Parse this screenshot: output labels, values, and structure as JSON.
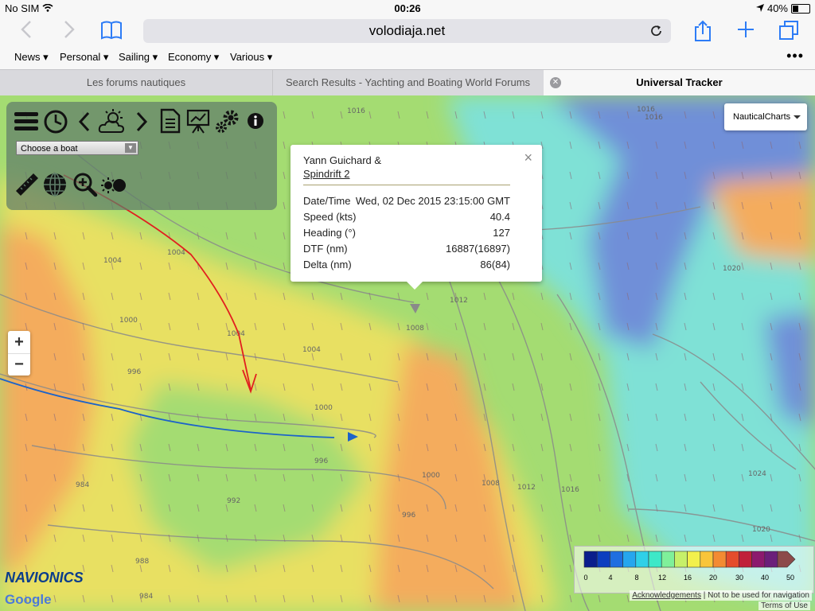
{
  "status": {
    "carrier": "No SIM",
    "wifi_icon": "wifi-icon",
    "time": "00:26",
    "battery": "40%",
    "battery_level": 0.4
  },
  "browser": {
    "url": "volodiaja.net",
    "bookmarks": [
      "News ▾",
      "Personal ▾",
      "Sailing ▾",
      "Economy ▾",
      "Various ▾"
    ],
    "more": "•••",
    "tabs": [
      "Les forums nautiques",
      "Search Results - Yachting and Boating World Forums",
      "Universal Tracker"
    ],
    "tab_close": "✕"
  },
  "map": {
    "boat_select": "Choose a boat",
    "layer": "NauticalCharts",
    "zoom_in": "+",
    "zoom_out": "−",
    "colors": {
      "orange": "#f4ac5d",
      "yellow": "#e8e062",
      "green": "#a4dc72",
      "cyan": "#7fe1d6",
      "blue": "#6f8fd8",
      "track_red": "#e11f1f",
      "track_blue": "#1c63c9"
    },
    "isobars": [
      "1016",
      "1016",
      "1012",
      "1008",
      "1004",
      "1000",
      "1004",
      "1004",
      "1000",
      "996",
      "996",
      "992",
      "988",
      "984",
      "984",
      "1000",
      "1004",
      "1008",
      "1012",
      "1016",
      "996",
      "1016",
      "1020",
      "1024",
      "1020"
    ]
  },
  "popup": {
    "name": "Yann Guichard &",
    "boat": "Spindrift 2",
    "close": "×",
    "rows": [
      {
        "k": "Date/Time",
        "v": "Wed, 02 Dec 2015 23:15:00 GMT"
      },
      {
        "k": "Speed (kts)",
        "v": "40.4"
      },
      {
        "k": "Heading (°)",
        "v": "127"
      },
      {
        "k": "DTF (nm)",
        "v": "16887(16897)"
      },
      {
        "k": "Delta (nm)",
        "v": "86(84)"
      }
    ]
  },
  "legend": {
    "ticks": [
      "0",
      "4",
      "8",
      "12",
      "16",
      "20",
      "30",
      "40",
      "50"
    ],
    "colors": [
      "#0a1e8c",
      "#0c3fbf",
      "#1f6fe0",
      "#26a6ee",
      "#2fd0e8",
      "#3ee8c8",
      "#7ff09a",
      "#c6f06a",
      "#f2f04c",
      "#f9c53b",
      "#f38b32",
      "#e44c2c",
      "#c0213a",
      "#8c1a6e",
      "#6b1f7a",
      "#8c4a4a"
    ]
  },
  "footer": {
    "acknowledgements": "Acknowledgements",
    "disclaimer": "| Not to be used for navigation",
    "terms": "Terms of Use",
    "navionics": "NAVIONICS",
    "google": "Google"
  }
}
